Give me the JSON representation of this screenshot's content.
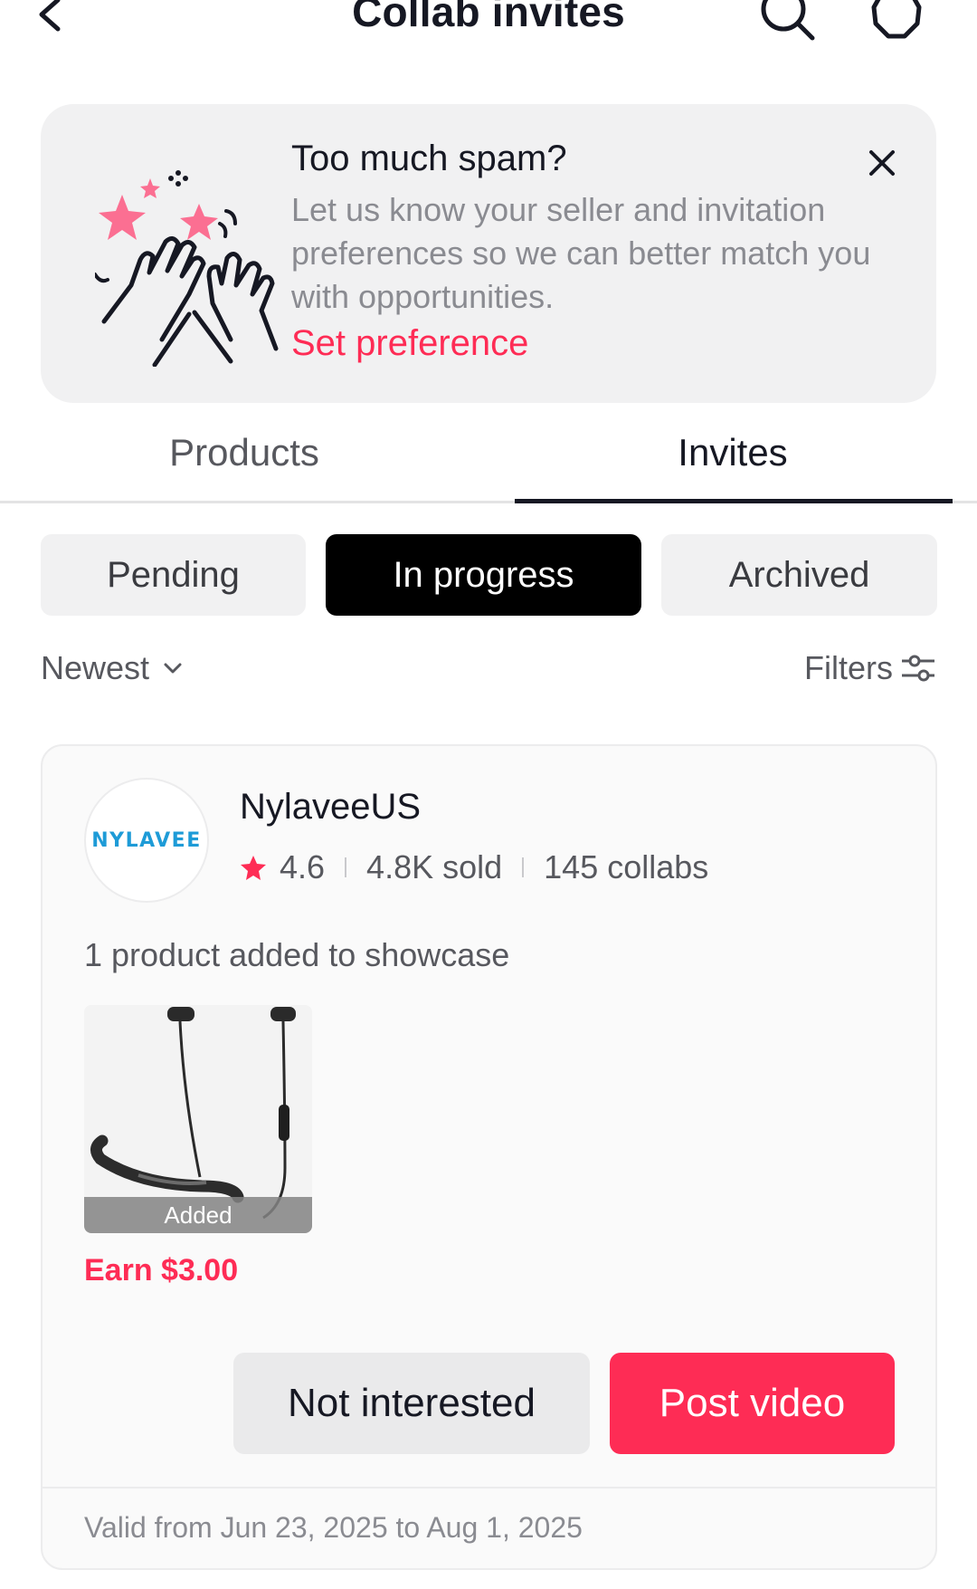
{
  "header": {
    "title": "Collab invites",
    "back_icon": "chevron-left-icon",
    "search_icon": "search-icon",
    "settings_icon": "gear-icon"
  },
  "banner": {
    "title": "Too much spam?",
    "text": "Let us know your seller and invitation preferences so we can better match you with opportunities.",
    "link": "Set preference",
    "close_icon": "close-icon",
    "illustration": "high-five-sparkles-illustration"
  },
  "tabs": {
    "items": [
      {
        "label": "Products",
        "active": false
      },
      {
        "label": "Invites",
        "active": true
      }
    ]
  },
  "segments": {
    "items": [
      {
        "label": "Pending",
        "active": false
      },
      {
        "label": "In progress",
        "active": true
      },
      {
        "label": "Archived",
        "active": false
      }
    ]
  },
  "sort": {
    "label": "Newest"
  },
  "filters": {
    "label": "Filters"
  },
  "card": {
    "seller": {
      "name": "NylaveeUS",
      "logo_text": "NYLAVEE",
      "rating": "4.6",
      "sold": "4.8K sold",
      "collabs": "145 collabs"
    },
    "showcase_text": "1 product added to showcase",
    "product": {
      "image": "neckband-earphones",
      "status": "Added",
      "earn": "Earn $3.00"
    },
    "actions": {
      "not_interested": "Not interested",
      "post_video": "Post video"
    },
    "validity": "Valid from Jun 23, 2025 to Aug 1, 2025"
  },
  "colors": {
    "accent": "#fe2c55",
    "text_primary": "#161823",
    "text_secondary": "#57585e",
    "text_muted": "#8a8b91",
    "surface": "#f1f1f2"
  }
}
